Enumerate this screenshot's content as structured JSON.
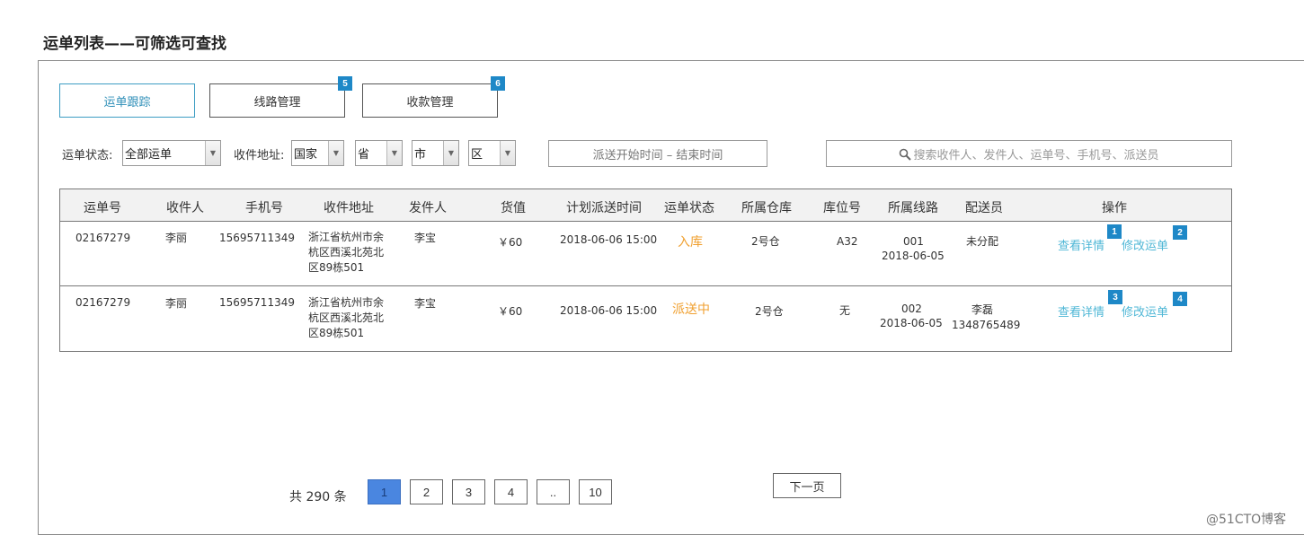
{
  "page_title": "运单列表——可筛选可查找",
  "tabs": [
    {
      "label": "运单跟踪",
      "marker": ""
    },
    {
      "label": "线路管理",
      "marker": "5"
    },
    {
      "label": "收款管理",
      "marker": "6"
    }
  ],
  "filters": {
    "status_label": "运单状态:",
    "status_value": "全部运单",
    "address_label": "收件地址:",
    "country_value": "国家",
    "province_value": "省",
    "city_value": "市",
    "district_value": "区",
    "date_range_placeholder": "派送开始时间 – 结束时间",
    "search_placeholder": "搜索收件人、发件人、运单号、手机号、派送员"
  },
  "table": {
    "headers": [
      "运单号",
      "收件人",
      "手机号",
      "收件地址",
      "发件人",
      "货值",
      "计划派送时间",
      "运单状态",
      "所属仓库",
      "库位号",
      "所属线路",
      "配送员",
      "操作"
    ],
    "rows": [
      {
        "order_no": "02167279",
        "recipient": "李丽",
        "phone": "15695711349",
        "address": "浙江省杭州市余杭区西溪北苑北区89栋501",
        "sender": "李宝",
        "value": "￥60",
        "planned_time": "2018-06-06 15:00",
        "status": "入库",
        "warehouse": "2号仓",
        "location": "A32",
        "route_no": "001",
        "route_date": "2018-06-05",
        "courier_name": "未分配",
        "courier_phone": "",
        "view_label": "查看详情",
        "view_marker": "1",
        "edit_label": "修改运单",
        "edit_marker": "2"
      },
      {
        "order_no": "02167279",
        "recipient": "李丽",
        "phone": "15695711349",
        "address": "浙江省杭州市余杭区西溪北苑北区89栋501",
        "sender": "李宝",
        "value": "￥60",
        "planned_time": "2018-06-06 15:00",
        "status": "派送中",
        "warehouse": "2号仓",
        "location": "无",
        "route_no": "002",
        "route_date": "2018-06-05",
        "courier_name": "李磊",
        "courier_phone": "1348765489",
        "view_label": "查看详情",
        "view_marker": "3",
        "edit_label": "修改运单",
        "edit_marker": "4"
      }
    ]
  },
  "pagination": {
    "total": "共 290 条",
    "pages": [
      "1",
      "2",
      "3",
      "4",
      "..",
      "10"
    ],
    "current": "1",
    "next_label": "下一页"
  },
  "watermark": "@51CTO博客",
  "colors": {
    "accent_link": "#4fb7d6",
    "marker_blue": "#1e88c7",
    "status_orange": "#f0a030",
    "active_page": "#4a86e0"
  }
}
